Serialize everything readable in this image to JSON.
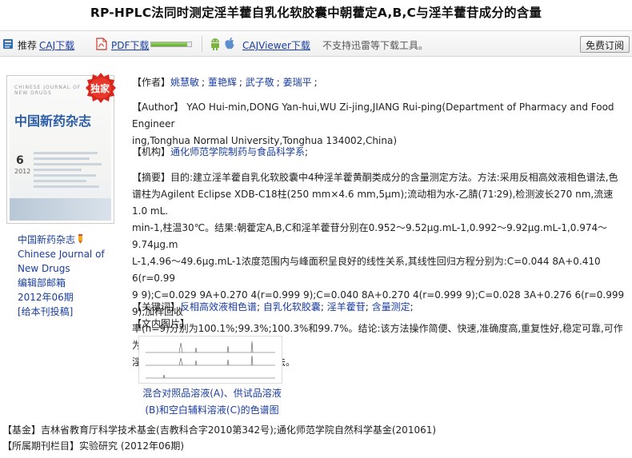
{
  "title": "RP-HPLC法同时测定淫羊藿自乳化软胶囊中朝藿定A,B,C与淫羊藿苷成分的含量",
  "toolbar": {
    "recommend_label": "推荐",
    "caj_download": "CAJ下载",
    "pdf_download": "PDF下载",
    "pdf_progress": 0.9,
    "cajviewer_download": "CAJViewer下载",
    "thunder_note": "不支持迅雷等下载工具。",
    "free_subscribe": "免费订阅"
  },
  "cover": {
    "badge_text": "独家",
    "journal_name": "中国新药杂志",
    "english_top": "CHINESE JOURNAL OF NEW DRUGS",
    "issue": "6",
    "year": "2012"
  },
  "journal_info": {
    "cn_name": "中国新药杂志",
    "en_line1": "Chinese Journal of",
    "en_line2": "New Drugs",
    "editor_office": "编辑部邮箱",
    "issue": "2012年06期",
    "submit": "[给本刊投稿]"
  },
  "labels": {
    "author": "【作者】",
    "author_en": "【Author】",
    "institution": "【机构】",
    "abstract": "【摘要】",
    "keywords": "【关键词】",
    "figures": "【文内图片】",
    "fund": "【基金】",
    "column": "【所属期刊栏目】"
  },
  "authors": [
    "姚慧敏",
    "董艳辉",
    "武子敬",
    "姜瑞平"
  ],
  "author_en_line1": "YAO Hui-min,DONG Yan-hui,WU Zi-jing,JIANG Rui-ping(Department of Pharmacy and Food Engineer",
  "author_en_line2": "ing,Tonghua Normal University,Tonghua 134002,China)",
  "institution": "通化师范学院制药与食品科学系",
  "abstract_lines": [
    "目的:建立淫羊藿自乳化软胶囊中4种淫羊藿黄酮类成分的含量测定方法。方法:采用反相高效液相色谱法,色",
    "谱柱为Agilent Eclipse XDB-C18柱(250 mm×4.6 mm,5μm);流动相为水-乙腈(71∶29),检测波长270 nm,流速1.0 mL.",
    "min-1,柱温30℃。结果:朝藿定A,B,C和淫羊藿苷分别在0.952～9.52μg.mL-1,0.992～9.92μg.mL-1,0.974～9.74μg.m",
    "L-1,4.96～49.6μg.mL-1浓度范围内与峰面积呈良好的线性关系,其线性回归方程分别为:C=0.044 8A+0.410 6(r=0.99",
    "9 9);C=0.029 9A+0.270 4(r=0.999 9);C=0.040 8A+0.270 4(r=0.999 9);C=0.028 3A+0.276 6(r=0.999 9),加样回收",
    "率(n=9)分别为100.1%;99.3%;100.3%和99.7%。结论:该方法操作简便、快速,准确度高,重复性好,稳定可靠,可作为",
    "淫羊藿自乳化软胶囊质量控制的方法。"
  ],
  "keywords": [
    "反相高效液相色谱",
    "自乳化软胶囊",
    "淫羊藿苷",
    "含量测定"
  ],
  "figure_caption_line1": "混合对照品溶液(A)、供试品溶液",
  "figure_caption_line2": "(B)和空白辅料溶液(C)的色谱图",
  "fund": "吉林省教育厅科学技术基金(吉教科合字2010第342号);通化师范学院自然科学基金(201061)",
  "column": "实验研究 (2012年06期)",
  "colors": {
    "link": "#1a3da0",
    "badge_red": "#d8261c",
    "cover_title_blue": "#2c5ea8"
  }
}
